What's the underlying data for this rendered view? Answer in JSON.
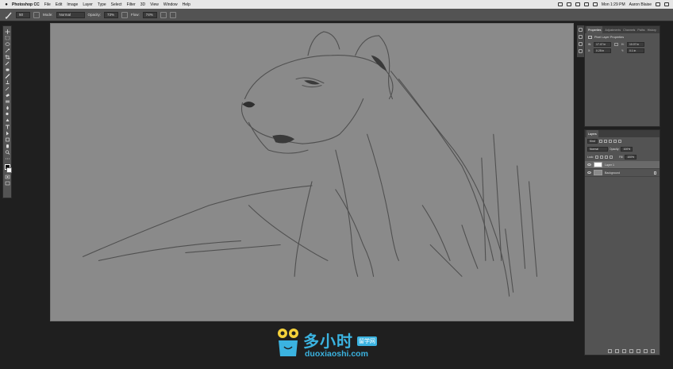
{
  "menubar": {
    "app_name": "Photoshop CC",
    "items": [
      "File",
      "Edit",
      "Image",
      "Layer",
      "Type",
      "Select",
      "Filter",
      "3D",
      "View",
      "Window",
      "Help"
    ],
    "clock": "Mon 1:29 PM",
    "user": "Aaron Blaise"
  },
  "options": {
    "brush_size": "50",
    "mode_label": "Mode:",
    "mode_value": "Normal",
    "opacity_label": "Opacity:",
    "opacity_value": "73%",
    "flow_label": "Flow:",
    "flow_value": "74%"
  },
  "properties": {
    "tabs": [
      "Properties",
      "Adjustments",
      "Channels",
      "Paths",
      "History"
    ],
    "title": "Pixel Layer Properties",
    "w_label": "W:",
    "w_value": "17.47 in",
    "h_label": "H:",
    "h_value": "10.07 in",
    "x_label": "X:",
    "x_value": "0.25 in",
    "y_label": "Y:",
    "y_value": "0.1 in"
  },
  "layers": {
    "tab": "Layers",
    "kind_value": "Kind",
    "blend_value": "Normal",
    "opacity_label": "Opacity:",
    "opacity_value": "100%",
    "lock_label": "Lock:",
    "fill_label": "Fill:",
    "fill_value": "100%",
    "items": [
      {
        "name": "Layer 1"
      },
      {
        "name": "Background"
      }
    ]
  },
  "watermark": {
    "cn": "多小时",
    "tag": "留学网",
    "en": "duoxiaoshi.com"
  },
  "colors": {
    "accent": "#3bb3e0",
    "canvas": "#8a8a8a",
    "panel": "#535353"
  }
}
